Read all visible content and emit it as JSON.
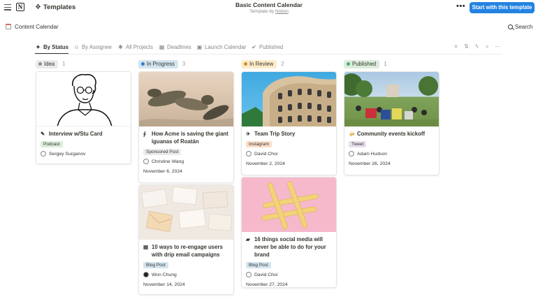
{
  "topbar": {
    "templates_label": "Templates",
    "doc_title": "Basic Content Calendar",
    "template_by_prefix": "Template by ",
    "template_by_link": "Notion",
    "more_label": "•••",
    "start_button": "Start with this template"
  },
  "breadcrumb": {
    "page_label": "Content Calendar",
    "search_label": "Search"
  },
  "tabs": [
    {
      "label": "By Status",
      "icon": "✦"
    },
    {
      "label": "By Assignee",
      "icon": "☺"
    },
    {
      "label": "All Projects",
      "icon": "✱"
    },
    {
      "label": "Deadlines",
      "icon": "▦"
    },
    {
      "label": "Launch Calendar",
      "icon": "▣"
    },
    {
      "label": "Published",
      "icon": "✔"
    }
  ],
  "columns": [
    {
      "name": "Idea",
      "count": "1",
      "color": "#8e8e8e",
      "bg": "#ebebea",
      "cards": [
        {
          "icon": "✎",
          "title": "Interview w/Stu Card",
          "tag": "Podcast",
          "tag_bg": "#dbeddb",
          "person": "Sergey Surganov",
          "date": ""
        }
      ]
    },
    {
      "name": "In Progress",
      "count": "3",
      "color": "#2e7cd6",
      "bg": "#d3e5ef",
      "cards": [
        {
          "icon": "∮",
          "title": "How Acme is saving the giant iguanas of Roatán",
          "tag": "Sponsored Post",
          "tag_bg": "#ebebea",
          "person": "Christine Wang",
          "date": "November 6, 2024"
        },
        {
          "icon": "▤",
          "title": "10 ways to re-engage users with drip email campaigns",
          "tag": "Blog Post",
          "tag_bg": "#d3e5ef",
          "person": "Won Chung",
          "date": "November 14, 2024"
        }
      ]
    },
    {
      "name": "In Review",
      "count": "2",
      "color": "#cb912f",
      "bg": "#fdecc8",
      "cards": [
        {
          "icon": "✈",
          "title": "Team Trip Story",
          "tag": "Instagram",
          "tag_bg": "#fadec9",
          "person": "David Choi",
          "date": "November 2, 2024"
        },
        {
          "icon": "▰",
          "title": "16 things social media will never be able to do for your brand",
          "tag": "Blog Post",
          "tag_bg": "#d3e5ef",
          "person": "David Choi",
          "date": "November 27, 2024"
        }
      ]
    },
    {
      "name": "Published",
      "count": "1",
      "color": "#4dab6d",
      "bg": "#dbeddb",
      "cards": [
        {
          "icon": "🍻",
          "title": "Community events kickoff",
          "tag": "Tweet",
          "tag_bg": "#e8deee",
          "person": "Adam Hudson",
          "date": "November 26, 2024"
        }
      ]
    }
  ],
  "colors": {
    "accent": "#2383e2",
    "text": "#37352f",
    "muted": "#9b9a97"
  }
}
